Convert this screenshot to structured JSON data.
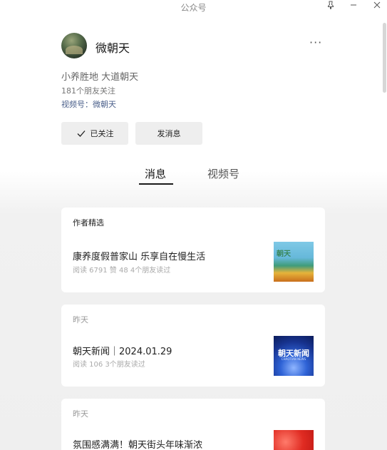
{
  "window": {
    "title": "公众号",
    "pin_icon": "pin-icon",
    "minimize_icon": "minimize-icon",
    "close_icon": "close-icon"
  },
  "profile": {
    "name": "微朝天",
    "bio": "小养胜地 大道朝天",
    "followers": "181个朋友关注",
    "channel": "视频号：微朝天",
    "more_label": "···"
  },
  "actions": {
    "follow_label": "已关注",
    "message_label": "发消息"
  },
  "tabs": [
    {
      "label": "消息",
      "active": true
    },
    {
      "label": "视频号",
      "active": false
    }
  ],
  "cards": [
    {
      "header": "作者精选",
      "title": "康养度假普家山 乐享自在慢生活",
      "meta": "阅读 6791   赞 48   4个朋友读过",
      "thumb_text": "朝天"
    },
    {
      "header": "昨天",
      "title": "朝天新闻｜2024.01.29",
      "meta": "阅读 106   3个朋友读过",
      "thumb_text": "朝天新闻",
      "thumb_sub": "CHAOTIAN NEWS"
    },
    {
      "header": "昨天",
      "title": "氛围感满满！朝天街头年味渐浓",
      "meta": ""
    }
  ],
  "colors": {
    "link": "#4a5f8a",
    "button_bg": "#eeeeee",
    "page_bg": "#efefef"
  }
}
